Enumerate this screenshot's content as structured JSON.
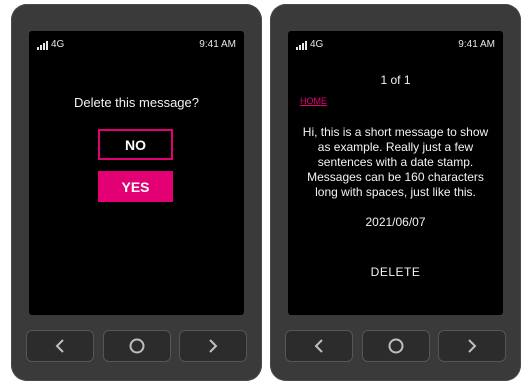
{
  "left_screen": {
    "status": {
      "network": "4G",
      "time": "9:41 AM"
    },
    "prompt": "Delete this message?",
    "no_label": "NO",
    "yes_label": "YES"
  },
  "right_screen": {
    "status": {
      "network": "4G",
      "time": "9:41 AM"
    },
    "page_count": "1 of 1",
    "sender": "HOME",
    "message": "Hi, this is a short message to show as example. Really just a few sentences with a date stamp. Messages can be 160 characters long with spaces, just like this.",
    "date_stamp": "2021/06/07",
    "delete_label": "DELETE"
  },
  "colors": {
    "accent": "#e20074",
    "screen_bg": "#000000",
    "device_body": "#3a3a3a"
  },
  "nav_icons": [
    "chevron-left-icon",
    "home-circle-icon",
    "chevron-right-icon"
  ]
}
